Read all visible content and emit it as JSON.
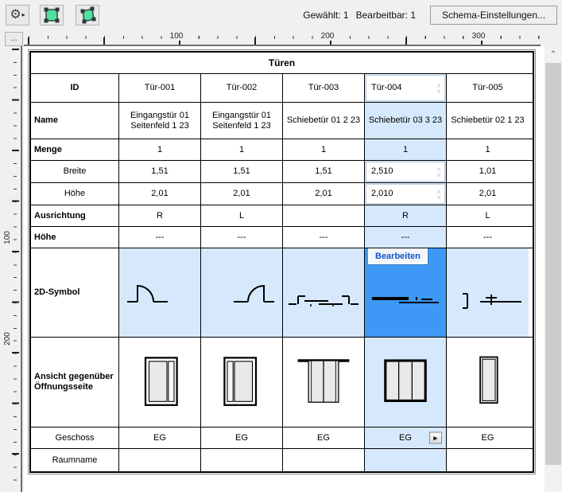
{
  "toolbar": {
    "status": {
      "selected": "Gewählt: 1",
      "editable": "Bearbeitbar: 1"
    },
    "settings_button": "Schema-Einstellungen..."
  },
  "ruler": {
    "corner_button": "...",
    "h_labels": [
      "100",
      "200",
      "300"
    ],
    "v_labels": [
      "100",
      "200"
    ]
  },
  "table": {
    "title": "Türen",
    "id": {
      "label": "ID",
      "values": [
        "Tür-001",
        "Tür-002",
        "Tür-003",
        "Tür-004",
        "Tür-005"
      ]
    },
    "name": {
      "label": "Name",
      "values": [
        "Eingangstür 01 Seitenfeld 1 23",
        "Eingangstür 01 Seitenfeld 1 23",
        "Schiebetür 01 2 23",
        "Schiebetür 03 3 23",
        "Schiebetür 02 1 23"
      ]
    },
    "menge": {
      "label": "Menge",
      "values": [
        "1",
        "1",
        "1",
        "1",
        "1"
      ]
    },
    "breite": {
      "label": "Breite",
      "values": [
        "1,51",
        "1,51",
        "1,51",
        "2,510",
        "1,01"
      ]
    },
    "hoehe": {
      "label": "Höhe",
      "values": [
        "2,01",
        "2,01",
        "2,01",
        "2,010",
        "2,01"
      ]
    },
    "ausrichtung": {
      "label": "Ausrichtung",
      "values": [
        "R",
        "L",
        "",
        "R",
        "L"
      ]
    },
    "hoehe2": {
      "label": "Höhe",
      "values": [
        "---",
        "---",
        "---",
        "---",
        "---"
      ]
    },
    "symbol2d": {
      "label": "2D-Symbol"
    },
    "ansicht": {
      "label": "Ansicht gegenüber Öffnungsseite"
    },
    "geschoss": {
      "label": "Geschoss",
      "values": [
        "EG",
        "EG",
        "EG",
        "EG",
        "EG"
      ]
    },
    "raumname": {
      "label": "Raumname",
      "values": [
        "",
        "",
        "",
        "",
        ""
      ]
    }
  },
  "selection": {
    "edit_button": "Bearbeiten"
  },
  "icons": {
    "toolbar": [
      "gear-icon",
      "flyout-arrow-icon",
      "marquee-select-icon",
      "rotated-marquee-select-icon"
    ],
    "symbols_2d": [
      "door-swing-right",
      "door-swing-left",
      "sliding-door-double",
      "sliding-door-single",
      "sliding-door-pocket"
    ],
    "elevations": [
      "door-two-panel-left",
      "door-two-panel-right",
      "door-sliding-header",
      "door-three-panel",
      "door-single-narrow"
    ]
  },
  "colors": {
    "selection_light": "#d6e9fc",
    "selection_strong": "#3d99f5",
    "icon_green": "#52e0a2",
    "edit_button_text": "#1253c4"
  }
}
